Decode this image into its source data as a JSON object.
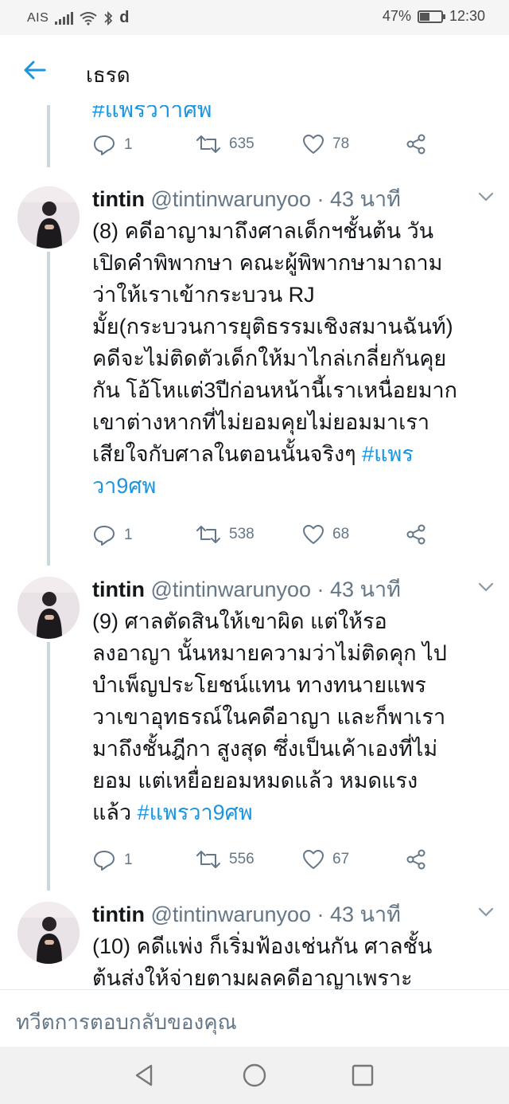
{
  "status_bar": {
    "carrier": "AIS",
    "extra_glyph": "d",
    "battery_percent": "47%",
    "battery_level": 0.47,
    "time": "12:30",
    "icons": [
      "signal-icon",
      "wifi-icon",
      "bluetooth-icon",
      "battery-icon"
    ]
  },
  "header": {
    "title": "เธรด",
    "back_icon": "arrow-left-icon"
  },
  "colors": {
    "accent": "#1b95e0",
    "muted": "#657786",
    "text": "#14171a",
    "thread_line": "#ccd6dd"
  },
  "top_partial": {
    "hashtag_fragment": "#แพรวาาศพ",
    "replies": "1",
    "retweets": "635",
    "likes": "78"
  },
  "tweets": [
    {
      "name": "tintin",
      "handle": "@tintinwarunyoo",
      "time": "· 43 นาที",
      "lines": [
        "(8) คดีอาญามาถึงศาลเด็กฯชั้นต้น วัน",
        "เปิดคำพิพากษา คณะผู้พิพากษามาถาม",
        "ว่าให้เราเข้ากระบวน RJ",
        "มั้ย(กระบวนการยุติธรรมเชิงสมานฉันท์)",
        "คดีจะไม่ติดตัวเด็กให้มาไกล่เกลี่ยกันคุย",
        "กัน โอ้โหแต่3ปีก่อนหน้านี้เราเหนื่อยมาก",
        "เขาต่างหากที่ไม่ยอมคุยไม่ยอมมาเรา"
      ],
      "last_line": "เสียใจกับศาลในตอนนั้นจริงๆ ",
      "hashtag": "#แพร",
      "hashtag_cont": "วา9ศพ",
      "replies": "1",
      "retweets": "538",
      "likes": "68"
    },
    {
      "name": "tintin",
      "handle": "@tintinwarunyoo",
      "time": "· 43 นาที",
      "lines": [
        "(9) ศาลตัดสินให้เขาผิด แต่ให้รอ",
        "ลงอาญา นั้นหมายความว่าไม่ติดคุก ไป",
        "บำเพ็ญประโยชน์แทน  ทางทนายแพร",
        "วาเขาอุทธรณ์ในคดีอาญา และก็พาเรา",
        "มาถึงชั้นฎีกา สูงสุด ซึ่งเป็นเค้าเองที่ไม่",
        "ยอม แต่เหยื่อยอมหมดแล้ว หมดแรง"
      ],
      "last_line": "แล้ว  ",
      "hashtag": "#แพรวา9ศพ",
      "replies": "1",
      "retweets": "556",
      "likes": "67"
    },
    {
      "name": "tintin",
      "handle": "@tintinwarunyoo",
      "time": "· 43 นาที",
      "lines": [
        "(10) คดีแพ่ง ก็เริ่มฟ้องเช่นกัน  ศาลชั้น",
        "ต้นส่งให้จ่ายตามผลคดีอาญาเพราะ"
      ]
    }
  ],
  "reply_bar": {
    "placeholder": "ทวีตการตอบกลับของคุณ"
  },
  "nav_bar": {
    "buttons": [
      "back-triangle-icon",
      "home-circle-icon",
      "recents-square-icon"
    ]
  }
}
